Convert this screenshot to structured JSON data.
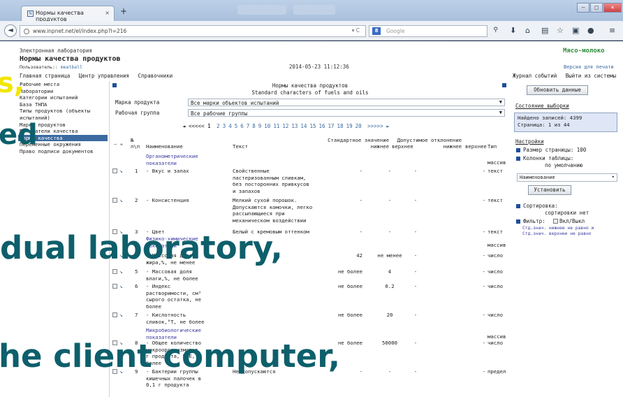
{
  "browser": {
    "tab_title": "Нормы качества продуктов",
    "new_tab": "+",
    "url": "www.inpnet.net/el/index.php?l=216",
    "search_placeholder": "Google",
    "window_controls": [
      "–",
      "□",
      "×"
    ]
  },
  "header": {
    "lab": "Электронная лаборатория",
    "title": "Нормы качества продуктов",
    "user_label": "Пользователь::",
    "user_name": "meatball",
    "datetime": "2014-05-23 11:12:36",
    "org": "Мясо-молоко",
    "print_version": "Версия для печати"
  },
  "menu": {
    "left": [
      "Главная страница",
      "Центр управления",
      "Справочники"
    ],
    "right": [
      "Журнал событий",
      "Выйти из системы"
    ]
  },
  "sidebar": {
    "items": [
      "Рабочие места",
      "Лаборатории",
      "Категории испытаний",
      "База ТНПА",
      "Типы продуктов (объекты испытаний)",
      "Марки продуктов",
      "Показатели качества",
      "Нормы качества",
      "Переменные окружения",
      "Право подписи документов"
    ],
    "active_index": 7
  },
  "main": {
    "title_ru": "Нормы качества продуктов",
    "title_en": "Standard characters of fuels and oils",
    "brand_label": "Марка продукта",
    "brand_value": "Все марки объектов испытаний",
    "group_label": "Рабочая группа",
    "group_value": "Все рабочие группы",
    "pager": {
      "first": "◄ <<<<<",
      "current": "1",
      "pages": [
        "2",
        "3",
        "4",
        "5",
        "6",
        "7",
        "8",
        "9",
        "10",
        "11",
        "12",
        "13",
        "14",
        "15",
        "16",
        "17",
        "18",
        "19",
        "20"
      ],
      "last": ">>>>> ►"
    },
    "columns": {
      "no": "№\nп\\п",
      "name": "Наименование",
      "text": "Текст",
      "std_low": "Стандартное значение\nнижнее",
      "std_high": "верхнее",
      "tol_low": "Допустимое отклонение\nнижнее",
      "tol_high": "верхнее",
      "type": "Тип"
    },
    "groups": {
      "organoleptic": "Органометрические\nпоказатели",
      "physchem": "Физико-химические\nпоказатели",
      "micro": "Микробиологические\nпоказатели"
    },
    "group_type": "массив",
    "rows": [
      {
        "no": "1",
        "name": "- Вкус и запах",
        "text": "Свойственные\nпастеризованным сливкам,\nбез посторонних привкусов\nи запахов",
        "std_low": "-",
        "std_high": "-",
        "tol_low": "-",
        "tol_high": "-",
        "type": "текст"
      },
      {
        "no": "2",
        "name": "- Консистенция",
        "text": "Мелкий сухой порошок.\nДопускаются комочки, легко\nрассыпающиеся при\nмеханическом воздействии",
        "std_low": "-",
        "std_high": "-",
        "tol_low": "-",
        "tol_high": "-",
        "type": "текст"
      },
      {
        "no": "3",
        "name": "- Цвет",
        "text": "Белый с кремовым оттенком",
        "std_low": "-",
        "std_high": "-",
        "tol_low": "-",
        "tol_high": "-",
        "type": "текст"
      },
      {
        "no": "4",
        "name": "- Массовая доля\nжира,%, не менее",
        "text": "",
        "std_low": "42",
        "std_high": "не менее",
        "tol_low": "-",
        "tol_high": "-",
        "type": "число"
      },
      {
        "no": "5",
        "name": "- Массовая доля\nвлаги,%, не более",
        "text": "",
        "std_low": "не более",
        "std_high": "4",
        "tol_low": "-",
        "tol_high": "-",
        "type": "число"
      },
      {
        "no": "6",
        "name": "- Индекс\nрастворимости, см³\nсырого остатка, не\nболее",
        "text": "",
        "std_low": "не более",
        "std_high": "0.2",
        "tol_low": "-",
        "tol_high": "-",
        "type": "число"
      },
      {
        "no": "7",
        "name": "- Кислотность\nсливок,°Т, не более",
        "text": "",
        "std_low": "не более",
        "std_high": "20",
        "tol_low": "-",
        "tol_high": "-",
        "type": "число"
      },
      {
        "no": "8",
        "name": "- Общее количество\nмикроорганизмов в\nг продукта, КОЕ,\nболее",
        "text": "",
        "std_low": "не более",
        "std_high": "50000",
        "tol_low": "-",
        "tol_high": "-",
        "type": "число"
      },
      {
        "no": "9",
        "name": "- Бактерии группы\nкишечных палочек в\n0,1 г продукта",
        "text": "Не допускаются",
        "std_low": "-",
        "std_high": "-",
        "tol_low": "-",
        "tol_high": "-",
        "type": "предел"
      }
    ]
  },
  "right_panel": {
    "refresh_button": "Обновить данные",
    "state_title": "Состояние выборки",
    "found": "Найдено записей: 4399",
    "page": "Страница: 1 из 44",
    "settings_title": "Настройки",
    "page_size": "Размер страницы: 100",
    "columns_label": "Колонки таблицы:",
    "columns_value": "по умолчанию",
    "dropdown_value": "Наименование",
    "set_button": "Установить",
    "sort_label": "Сортировка:",
    "sort_value": "сортировки нет",
    "filter_label": "Фильтр:",
    "filter_toggle": "Вкл/Выкл",
    "filter_note1": "Стд.знач. нижнее не равно и",
    "filter_note2": "Стд.знач. верхнее не равно"
  },
  "overlay": {
    "line1": "s,",
    "line2": "ed",
    "line3": "dual laboratory,",
    "line4": "he client computer,",
    "text_color": "#0d5f6b",
    "accent_color": "#f2e500"
  }
}
